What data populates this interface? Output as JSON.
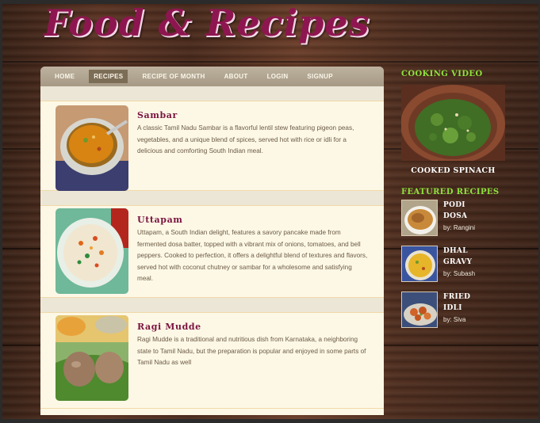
{
  "site": {
    "logo_text": "Food & Recipes"
  },
  "nav": {
    "items": [
      {
        "label": "HOME",
        "active": false
      },
      {
        "label": "RECIPES",
        "active": true
      },
      {
        "label": "RECIPE OF MONTH",
        "active": false
      },
      {
        "label": "ABOUT",
        "active": false
      },
      {
        "label": "LOGIN",
        "active": false
      },
      {
        "label": "SIGNUP",
        "active": false
      }
    ]
  },
  "posts": [
    {
      "title": "Sambar",
      "text": "A classic Tamil Nadu Sambar is a flavorful lentil stew featuring pigeon peas, vegetables, and a unique blend of spices, served hot with rice or idli for a delicious and comforting South Indian meal."
    },
    {
      "title": "Uttapam",
      "text": "Uttapam, a South Indian delight, features a savory pancake made from fermented dosa batter, topped with a vibrant mix of onions, tomatoes, and bell peppers. Cooked to perfection, it offers a delightful blend of textures and flavors, served hot with coconut chutney or sambar for a wholesome and satisfying meal."
    },
    {
      "title": "Ragi Mudde",
      "text": "Ragi Mudde is a traditional and nutritious dish from Karnataka, a neighboring state to Tamil Nadu, but the preparation is popular and enjoyed in some parts of Tamil Nadu as well"
    }
  ],
  "sidebar": {
    "video_heading": "COOKING VIDEO",
    "video_caption": "COOKED SPINACH",
    "featured_heading": "FEATURED RECIPES",
    "featured": [
      {
        "name_line1": "PODI",
        "name_line2": "DOSA",
        "by": "by: Rangini"
      },
      {
        "name_line1": "DHAL",
        "name_line2": "GRAVY",
        "by": "by: Subash"
      },
      {
        "name_line1": "FRIED",
        "name_line2": "IDLI",
        "by": "by: Siva"
      }
    ]
  },
  "colors": {
    "logo": "#8e1650",
    "heading_green": "#8ee23c",
    "post_title": "#7a1440",
    "nav_bg": "#a69a85",
    "content_bg": "#fdf8e6"
  }
}
